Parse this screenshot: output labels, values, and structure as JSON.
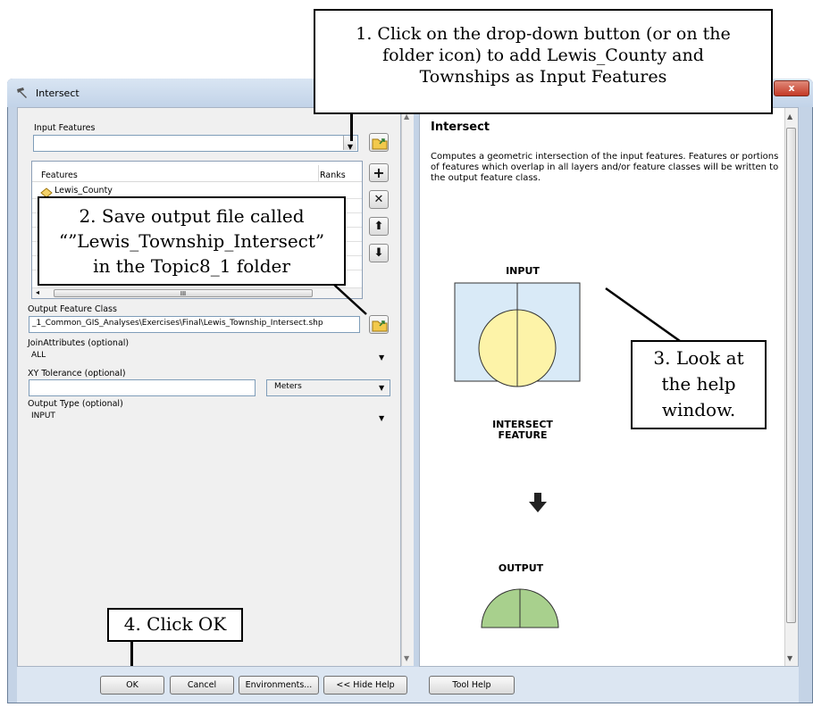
{
  "window": {
    "title": "Intersect",
    "close_label": "x"
  },
  "left": {
    "input_features_label": "Input Features",
    "list_header_features": "Features",
    "list_header_ranks": "Ranks",
    "list_items": [
      "Lewis_County"
    ],
    "output_label": "Output Feature Class",
    "output_value": "_1_Common_GIS_Analyses\\Exercises\\Final\\Lewis_Township_Intersect.shp",
    "join_label": "JoinAttributes (optional)",
    "join_value": "ALL",
    "xy_label": "XY Tolerance (optional)",
    "xy_units": "Meters",
    "type_label": "Output Type (optional)",
    "type_value": "INPUT",
    "hscroll_glyph": "III"
  },
  "help": {
    "title": "Intersect",
    "description": "Computes a geometric intersection of the input features. Features or portions of features which overlap in all layers and/or feature classes will be written to the output feature class.",
    "input_caption": "INPUT",
    "intersect_caption_1": "INTERSECT",
    "intersect_caption_2": "FEATURE",
    "output_caption": "OUTPUT"
  },
  "buttons": {
    "ok": "OK",
    "cancel": "Cancel",
    "environments": "Environments...",
    "hide_help": "<< Hide Help",
    "tool_help": "Tool Help"
  },
  "callouts": {
    "c1_l1": "1. Click on the drop-down button (or on the",
    "c1_l2": "folder icon) to add Lewis_County and",
    "c1_l3": "Townships as Input Features",
    "c2_l1": "2. Save output file called",
    "c2_l2": "“”Lewis_Township_Intersect”",
    "c2_l3": "in the Topic8_1 folder",
    "c3_l1": "3. Look at",
    "c3_l2": "the help",
    "c3_l3": "window.",
    "c4": "4. Click OK"
  },
  "colors": {
    "input_fill": "#d9eaf7",
    "circle_fill": "#fdf3a8",
    "output_fill": "#a8d08d",
    "diamond": "#f5d36a"
  }
}
